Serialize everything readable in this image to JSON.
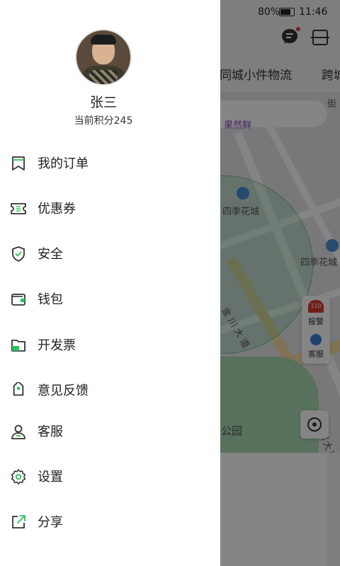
{
  "status_bar": {
    "battery": "80%",
    "time": "11:46"
  },
  "background": {
    "tabs": [
      "同城小件物流",
      "跨城"
    ],
    "map_labels": [
      "四季花城",
      "四季花城",
      "金川大道",
      "金川大道",
      "公园",
      "果然鲜",
      "街"
    ],
    "float_panel": {
      "alarm_badge": "110",
      "alarm_label": "报警",
      "service_label": "客服"
    }
  },
  "drawer": {
    "user": {
      "name": "张三",
      "points": "当前积分245"
    },
    "menu": [
      {
        "label": "我的订单",
        "icon": "bookmark-icon"
      },
      {
        "label": "优惠券",
        "icon": "coupon-icon"
      },
      {
        "label": "安全",
        "icon": "shield-icon"
      },
      {
        "label": "钱包",
        "icon": "wallet-icon"
      },
      {
        "label": "开发票",
        "icon": "folder-icon"
      },
      {
        "label": "意见反馈",
        "icon": "tag-icon"
      },
      {
        "label": "客服",
        "icon": "person-icon"
      },
      {
        "label": "设置",
        "icon": "gear-icon"
      },
      {
        "label": "分享",
        "icon": "share-icon"
      }
    ]
  },
  "colors": {
    "accent": "#2ec05a",
    "icon_stroke": "#333333",
    "overlay": "#000000"
  }
}
